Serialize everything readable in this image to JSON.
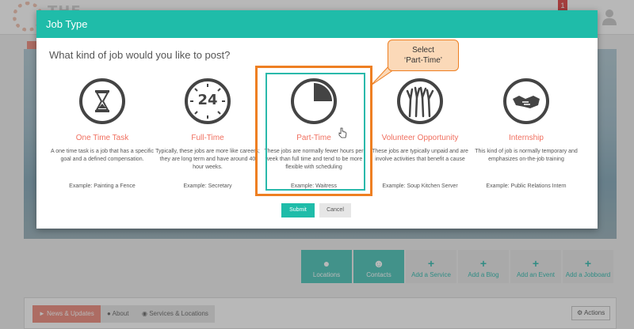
{
  "background": {
    "logo_text": "THE GOOD",
    "notification_count": "1",
    "tiles": [
      {
        "label": "Locations",
        "icon": "map-pin-icon",
        "style": "dark"
      },
      {
        "label": "Contacts",
        "icon": "people-icon",
        "style": "dark"
      },
      {
        "label": "Add a Service",
        "icon": "plus-icon",
        "style": "light"
      },
      {
        "label": "Add a Blog",
        "icon": "plus-icon",
        "style": "light"
      },
      {
        "label": "Add an Event",
        "icon": "plus-icon",
        "style": "light"
      },
      {
        "label": "Add a Jobboard",
        "icon": "plus-icon",
        "style": "light"
      }
    ],
    "tabs": [
      {
        "label": "News & Updates",
        "icon": "megaphone-icon",
        "active": true
      },
      {
        "label": "About",
        "icon": "user-icon",
        "active": false
      },
      {
        "label": "Services & Locations",
        "icon": "globe-icon",
        "active": false
      }
    ],
    "actions_label": "Actions"
  },
  "modal": {
    "title": "Job Type",
    "question": "What kind of job would you like to post?",
    "options": [
      {
        "title": "One Time Task",
        "icon": "hourglass-icon",
        "description": "A one time task is a job that has a specific goal and a defined compensation.",
        "example": "Example:  Painting a Fence"
      },
      {
        "title": "Full-Time",
        "icon": "clock-24-icon",
        "icon_text": "24",
        "description": "Typically, these jobs are more like careers; they are long term and have around 40 hour weeks.",
        "example": "Example:  Secretary"
      },
      {
        "title": "Part-Time",
        "icon": "pie-quarter-icon",
        "description": "These jobs are normally fewer hours per week than full time and tend to be more flexible with scheduling",
        "example": "Example:  Waitress",
        "selected": true
      },
      {
        "title": "Volunteer Opportunity",
        "icon": "raised-hands-icon",
        "description": "These jobs are typically unpaid and are involve activities that benefit a cause",
        "example": "Example:  Soup Kitchen Server"
      },
      {
        "title": "Internship",
        "icon": "handshake-icon",
        "description": "This kind of job is normally temporary and emphasizes on-the-job training",
        "example": "Example:  Public Relations Intern"
      }
    ],
    "submit_label": "Submit",
    "cancel_label": "Cancel"
  },
  "callout": {
    "line1": "Select",
    "line2": "‘Part-Time’"
  },
  "colors": {
    "accent": "#1fbca9",
    "job_title": "#f06f5f",
    "highlight": "#ee7f22",
    "callout_bg": "#fbd9b8"
  }
}
